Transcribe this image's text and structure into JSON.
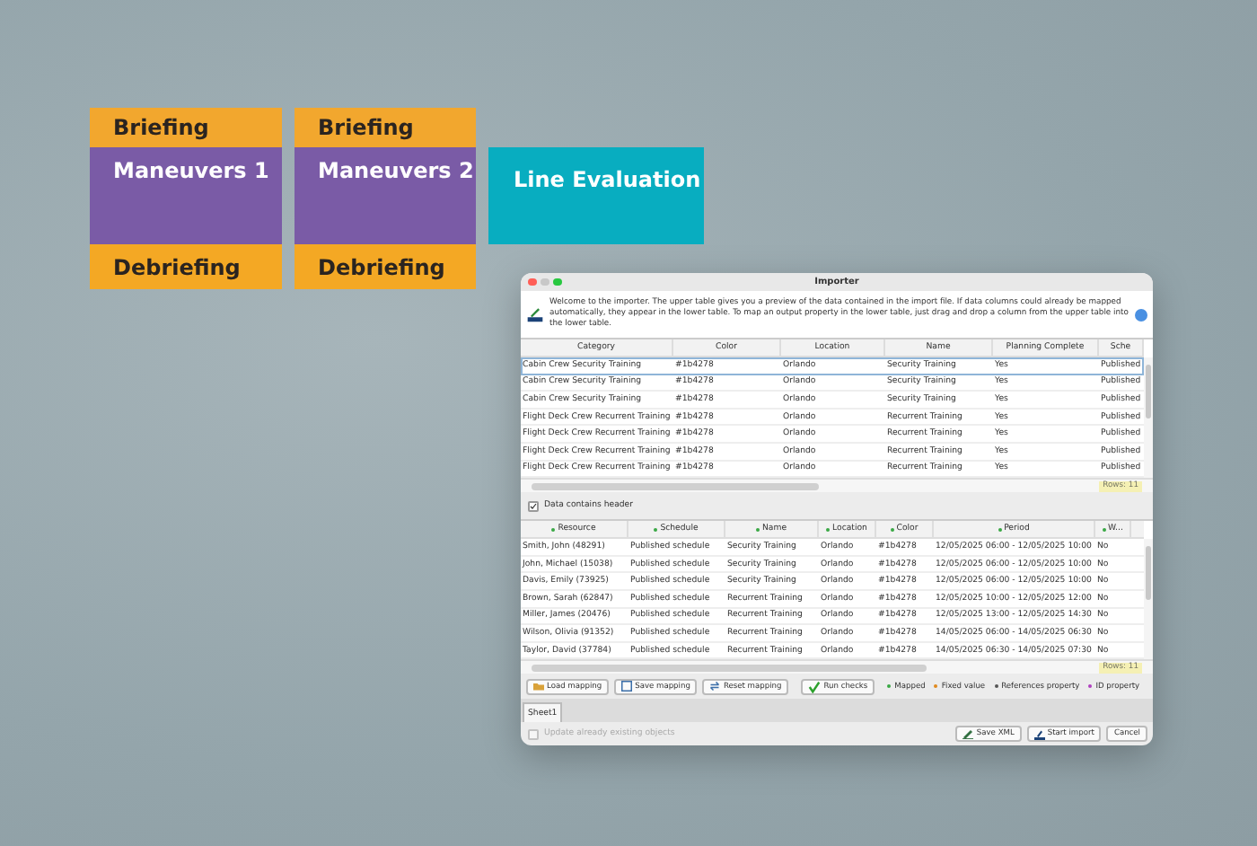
{
  "blocks": [
    {
      "items": [
        {
          "label": "Briefing",
          "kind": "briefing"
        },
        {
          "label": "Maneuvers 1",
          "kind": "maneuver"
        },
        {
          "label": "Debriefing",
          "kind": "debriefing"
        }
      ]
    },
    {
      "items": [
        {
          "label": "Briefing",
          "kind": "briefing"
        },
        {
          "label": "Maneuvers 2",
          "kind": "maneuver"
        },
        {
          "label": "Debriefing",
          "kind": "debriefing"
        }
      ]
    },
    {
      "items": [
        {
          "label": "Line Evaluation",
          "kind": "evaluation"
        }
      ]
    }
  ],
  "window": {
    "title": "Importer",
    "intro": "Welcome to the importer. The upper table gives you a preview of the data contained in the import file. If data columns could already be mapped automatically, they appear in the lower table. To map an output property in the lower table, just drag and drop a column from the upper table into the lower table."
  },
  "upper_table": {
    "columns": [
      "Category",
      "Color",
      "Location",
      "Name",
      "Planning Complete",
      "Sche"
    ],
    "rows": [
      {
        "selected": true,
        "cells": [
          "Cabin Crew Security Training",
          "#1b4278",
          "Orlando",
          "Security Training",
          "Yes",
          "Published"
        ]
      },
      {
        "selected": false,
        "cells": [
          "Cabin Crew Security Training",
          "#1b4278",
          "Orlando",
          "Security Training",
          "Yes",
          "Published"
        ]
      },
      {
        "selected": false,
        "cells": [
          "Cabin Crew Security Training",
          "#1b4278",
          "Orlando",
          "Security Training",
          "Yes",
          "Published"
        ]
      },
      {
        "selected": false,
        "cells": [
          "Flight Deck Crew Recurrent Training",
          "#1b4278",
          "Orlando",
          "Recurrent Training",
          "Yes",
          "Published"
        ]
      },
      {
        "selected": false,
        "cells": [
          "Flight Deck Crew Recurrent Training",
          "#1b4278",
          "Orlando",
          "Recurrent Training",
          "Yes",
          "Published"
        ]
      },
      {
        "selected": false,
        "cells": [
          "Flight Deck Crew Recurrent Training",
          "#1b4278",
          "Orlando",
          "Recurrent Training",
          "Yes",
          "Published"
        ]
      },
      {
        "selected": false,
        "cells": [
          "Flight Deck Crew Recurrent Training",
          "#1b4278",
          "Orlando",
          "Recurrent Training",
          "Yes",
          "Published"
        ]
      }
    ],
    "row_count": "Rows: 11"
  },
  "header_checkbox": {
    "label": "Data contains header",
    "checked": true
  },
  "lower_table": {
    "columns": [
      "Resource",
      "Schedule",
      "Name",
      "Location",
      "Color",
      "Period",
      "W..."
    ],
    "rows": [
      [
        "Smith, John (48291)",
        "Published schedule",
        "Security Training",
        "Orlando",
        "#1b4278",
        "12/05/2025 06:00 - 12/05/2025 10:00",
        "No"
      ],
      [
        "John, Michael (15038)",
        "Published schedule",
        "Security Training",
        "Orlando",
        "#1b4278",
        "12/05/2025 06:00 - 12/05/2025 10:00",
        "No"
      ],
      [
        "Davis, Emily (73925)",
        "Published schedule",
        "Security Training",
        "Orlando",
        "#1b4278",
        "12/05/2025 06:00 - 12/05/2025 10:00",
        "No"
      ],
      [
        "Brown, Sarah (62847)",
        "Published schedule",
        "Recurrent Training",
        "Orlando",
        "#1b4278",
        "12/05/2025 10:00 - 12/05/2025 12:00",
        "No"
      ],
      [
        "Miller, James (20476)",
        "Published schedule",
        "Recurrent Training",
        "Orlando",
        "#1b4278",
        "12/05/2025 13:00 - 12/05/2025 14:30",
        "No"
      ],
      [
        "Wilson, Olivia (91352)",
        "Published schedule",
        "Recurrent Training",
        "Orlando",
        "#1b4278",
        "14/05/2025 06:00 - 14/05/2025 06:30",
        "No"
      ],
      [
        "Taylor, David (37784)",
        "Published schedule",
        "Recurrent Training",
        "Orlando",
        "#1b4278",
        "14/05/2025 06:30 - 14/05/2025 07:30",
        "No"
      ]
    ],
    "row_count": "Rows: 11"
  },
  "buttons": [
    "Load mapping",
    "Save mapping",
    "Reset mapping",
    "Run checks"
  ],
  "legend": [
    {
      "label": "Mapped",
      "color": "#3aa845"
    },
    {
      "label": "Fixed value",
      "color": "#e08a1e"
    },
    {
      "label": "References property",
      "color": "#555555"
    },
    {
      "label": "ID property",
      "color": "#b040c0"
    }
  ],
  "sheets": [
    {
      "label": "Sheet1",
      "selected": true
    }
  ],
  "update_checkbox": {
    "label": "Update already existing objects",
    "checked": false,
    "disabled": true
  },
  "footer_buttons": [
    "Save XML",
    "Start import",
    "Cancel"
  ]
}
